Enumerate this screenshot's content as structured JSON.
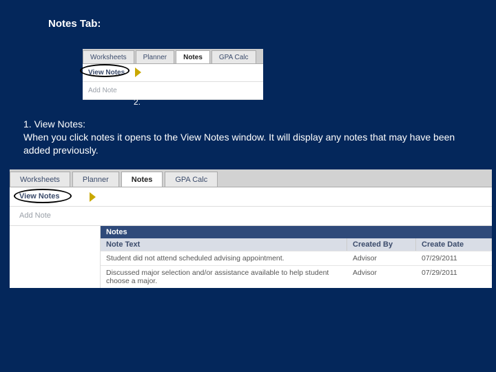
{
  "title": "Notes Tab:",
  "tabs": [
    "Worksheets",
    "Planner",
    "Notes",
    "GPA Calc"
  ],
  "active_tab_index": 2,
  "subitems": [
    "View Notes",
    "Add Note"
  ],
  "numbers": [
    "1.",
    "2."
  ],
  "section_heading": "1. View Notes:",
  "section_body": "When you click notes it opens to the View Notes window. It will display any notes that may have been added previously.",
  "notes_panel": {
    "title": "Notes",
    "columns": [
      "Note Text",
      "Created By",
      "Create Date"
    ],
    "rows": [
      {
        "text": "Student did not attend scheduled advising appointment.",
        "by": "Advisor",
        "date": "07/29/2011"
      },
      {
        "text": "Discussed major selection and/or assistance available to help student choose a major.",
        "by": "Advisor",
        "date": "07/29/2011"
      }
    ]
  }
}
